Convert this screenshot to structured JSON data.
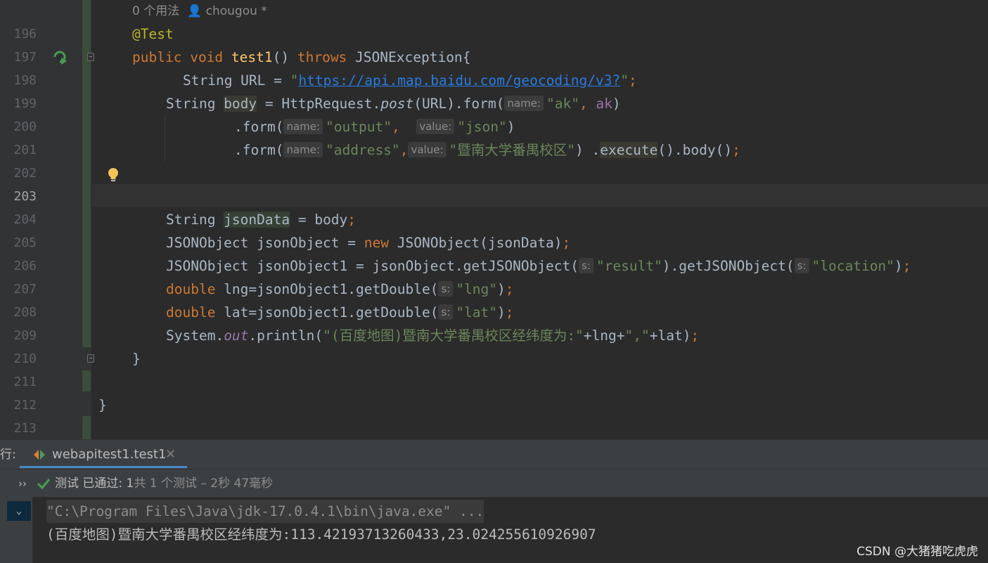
{
  "editor": {
    "usage_hint": "0 个用法",
    "author_hint": "chougou *",
    "line_numbers": [
      "196",
      "197",
      "198",
      "199",
      "200",
      "201",
      "202",
      "203",
      "204",
      "205",
      "206",
      "207",
      "208",
      "209",
      "210",
      "211",
      "212",
      "213"
    ],
    "current_line": "203",
    "lines": {
      "l196": {
        "annotation": "@Test"
      },
      "l197": {
        "public": "public",
        "void": "void",
        "method": "test1",
        "parens": "() ",
        "throws": "throws",
        "exc": " JSONException{"
      },
      "l198": {
        "type": "String URL = ",
        "url": "https://api.map.baidu.com/geocoding/v3?",
        "q1": "\"",
        "q2": "\"",
        "semi": ";"
      },
      "l199": {
        "type": "String ",
        "var": "body",
        "eq": " = HttpRequest.",
        "post": "post",
        "rest": "(URL).form(",
        "hint": "name:",
        "str": "\"ak\"",
        "comma": ", ",
        "param": "ak",
        "close": ")"
      },
      "l200": {
        "pre": ".form(",
        "hint1": "name:",
        "str1": "\"output\"",
        "comma": ",  ",
        "hint2": "value:",
        "str2": "\"json\"",
        "close": ")"
      },
      "l201": {
        "pre": ".form(",
        "hint1": "name:",
        "str1": "\"address\"",
        "comma": ",",
        "hint2": "value:",
        "str2": "\"暨南大学番禺校区\"",
        "mid": ") .",
        "exec": "execute",
        "rest": "().body()",
        "semi": ";"
      },
      "l204": {
        "type": "String ",
        "var": "jsonData",
        "rest": " = body",
        "semi": ";"
      },
      "l205": {
        "pre": "JSONObject jsonObject = ",
        "new": "new",
        "rest": " JSONObject(jsonData)",
        "semi": ";"
      },
      "l206": {
        "pre": "JSONObject jsonObject1 = jsonObject.getJSONObject(",
        "hint1": "s:",
        "str1": "\"result\"",
        "mid": ").getJSONObject(",
        "hint2": "s:",
        "str2": "\"location\"",
        "close": ")",
        "semi": ";"
      },
      "l207": {
        "kw": "double",
        "pre": " lng=jsonObject1.getDouble(",
        "hint": "s:",
        "str": "\"lng\"",
        "close": ")",
        "semi": ";"
      },
      "l208": {
        "kw": "double",
        "pre": " lat=jsonObject1.getDouble(",
        "hint": "s:",
        "str": "\"lat\"",
        "close": ")",
        "semi": ";"
      },
      "l209": {
        "pre": "System.",
        "out": "out",
        "mid": ".println(",
        "str1": "\"(百度地图)暨南大学番禺校区经纬度为:\"",
        "plus1": "+lng+",
        "str2": "\",\"",
        "plus2": "+lat)",
        "semi": ";"
      },
      "l210": {
        "brace": "}"
      },
      "l212": {
        "brace": "}"
      }
    }
  },
  "run_panel": {
    "label": "行:",
    "tab_label": "webapitest1.test1",
    "close_glyph": "✕",
    "expand_glyph": "››",
    "status_prefix": "测试 已通过: ",
    "status_count": "1",
    "status_rest": "共 1 个测试 – 2秒 47毫秒",
    "collapse_glyph": "⌄",
    "console": {
      "command": "\"C:\\Program Files\\Java\\jdk-17.0.4.1\\bin\\java.exe\" ...",
      "output": "(百度地图)暨南大学番禺校区经纬度为:113.42193713260433,23.024255610926907"
    }
  },
  "watermark": "CSDN @大猪猪吃虎虎",
  "colors": {
    "background": "#2b2b2b",
    "gutter": "#313335",
    "keyword": "#cc7832",
    "string": "#6a8759",
    "method": "#ffc66d",
    "annotation": "#bbb529",
    "field": "#9876aa",
    "url": "#287bde",
    "pass_green": "#499c54"
  },
  "icons": [
    "run-test-passed-icon",
    "intention-bulb-icon",
    "fold-icon",
    "java-run-config-icon",
    "check-icon",
    "user-icon",
    "chevron-down-icon"
  ]
}
